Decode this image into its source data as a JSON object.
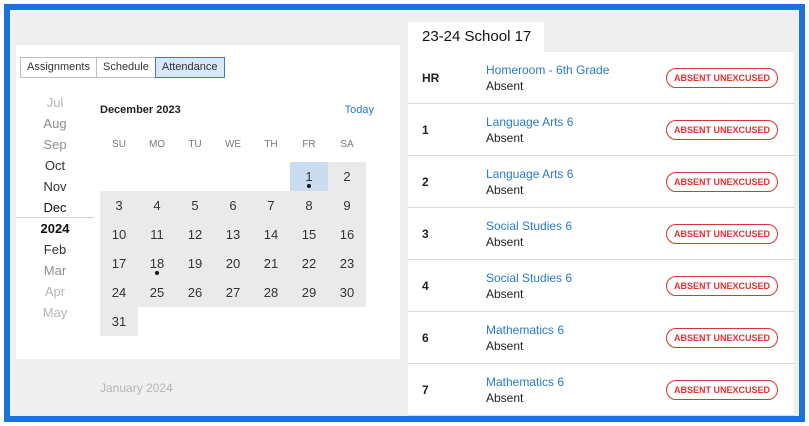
{
  "tabs": [
    "Assignments",
    "Schedule",
    "Attendance"
  ],
  "active_tab": "Attendance",
  "months": [
    {
      "label": "Jul",
      "style": "dim"
    },
    {
      "label": "Aug",
      "style": "mid"
    },
    {
      "label": "Sep",
      "style": "mid"
    },
    {
      "label": "Oct",
      "style": ""
    },
    {
      "label": "Nov",
      "style": ""
    },
    {
      "label": "Dec",
      "style": "current"
    },
    {
      "label": "2024",
      "style": "year"
    },
    {
      "label": "Feb",
      "style": ""
    },
    {
      "label": "Mar",
      "style": "mid"
    },
    {
      "label": "Apr",
      "style": "dim"
    },
    {
      "label": "May",
      "style": "dim"
    }
  ],
  "calendar": {
    "title": "December 2023",
    "today_label": "Today",
    "weekdays": [
      "SU",
      "MO",
      "TU",
      "WE",
      "TH",
      "FR",
      "SA"
    ],
    "weeks": [
      [
        "",
        "",
        "",
        "",
        "",
        "1",
        "2"
      ],
      [
        "3",
        "4",
        "5",
        "6",
        "7",
        "8",
        "9"
      ],
      [
        "10",
        "11",
        "12",
        "13",
        "14",
        "15",
        "16"
      ],
      [
        "17",
        "18",
        "19",
        "20",
        "21",
        "22",
        "23"
      ],
      [
        "24",
        "25",
        "26",
        "27",
        "28",
        "29",
        "30"
      ],
      [
        "31",
        "",
        "",
        "",
        "",
        "",
        ""
      ]
    ],
    "selected_day": "1",
    "marked_days": [
      "1",
      "18"
    ],
    "next_month_label": "January 2024"
  },
  "school_title": "23-24 School 17",
  "attendance_rows": [
    {
      "period": "HR",
      "course": "Homeroom - 6th Grade",
      "status": "Absent",
      "badge": "ABSENT UNEXCUSED"
    },
    {
      "period": "1",
      "course": "Language Arts 6",
      "status": "Absent",
      "badge": "ABSENT UNEXCUSED"
    },
    {
      "period": "2",
      "course": "Language Arts 6",
      "status": "Absent",
      "badge": "ABSENT UNEXCUSED"
    },
    {
      "period": "3",
      "course": "Social Studies 6",
      "status": "Absent",
      "badge": "ABSENT UNEXCUSED"
    },
    {
      "period": "4",
      "course": "Social Studies 6",
      "status": "Absent",
      "badge": "ABSENT UNEXCUSED"
    },
    {
      "period": "6",
      "course": "Mathematics 6",
      "status": "Absent",
      "badge": "ABSENT UNEXCUSED"
    },
    {
      "period": "7",
      "course": "Mathematics 6",
      "status": "Absent",
      "badge": "ABSENT UNEXCUSED"
    }
  ],
  "colors": {
    "frame_border": "#1a73d9",
    "link_blue": "#2a7ac7",
    "badge_red": "#dd3333",
    "selected_day_bg": "#c9dcf0"
  }
}
